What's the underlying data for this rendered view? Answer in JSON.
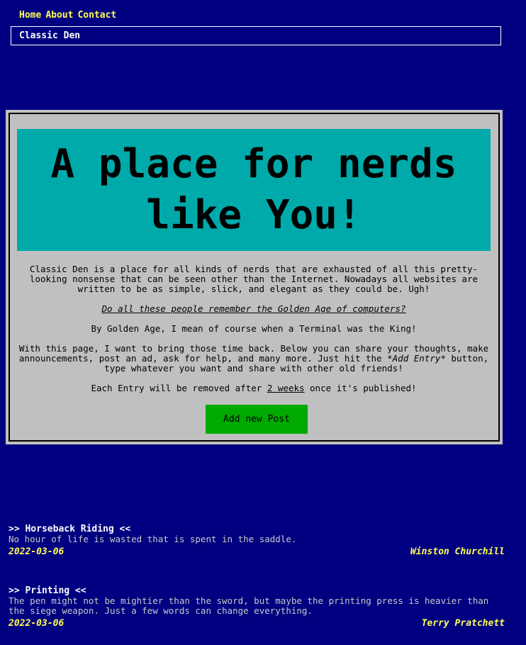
{
  "nav": {
    "items": [
      "Home",
      "About",
      "Contact"
    ]
  },
  "brand": {
    "name": "Classic Den"
  },
  "hero": {
    "line1": "A place for nerds",
    "line2": "like You!"
  },
  "intro": {
    "p1": "Classic Den is a place for all kinds of nerds that are exhausted of all this pretty-looking nonsense that can be seen other than the Internet. Nowadays all websites are written to be as simple, slick, and elegant as they could be. Ugh!",
    "question": "Do all these people remember the Golden Age of computers?",
    "p2": "By Golden Age, I mean of course when a Terminal was the King!",
    "p3_before": "With this page, I want to bring those time back. Below you can share your thoughts, make announcements, post an ad, ask for help, and many more. Just hit the ",
    "p3_em": "*Add Entry*",
    "p3_after": " button, type whatever you want and share with other old friends!",
    "p4_before": "Each Entry will be removed after ",
    "p4_u": "2 weeks",
    "p4_after": " once it's published!"
  },
  "actions": {
    "add_post": "Add new Post"
  },
  "posts": [
    {
      "title": ">> Horseback Riding <<",
      "body": "No hour of life is wasted that is spent in the saddle.",
      "date": "2022-03-06",
      "author": "Winston Churchill"
    },
    {
      "title": ">> Printing <<",
      "body": "The pen might not be mightier than the sword, but maybe the printing press is heavier than the siege weapon. Just a few words can change everything.",
      "date": "2022-03-06",
      "author": "Terry Pratchett"
    }
  ]
}
